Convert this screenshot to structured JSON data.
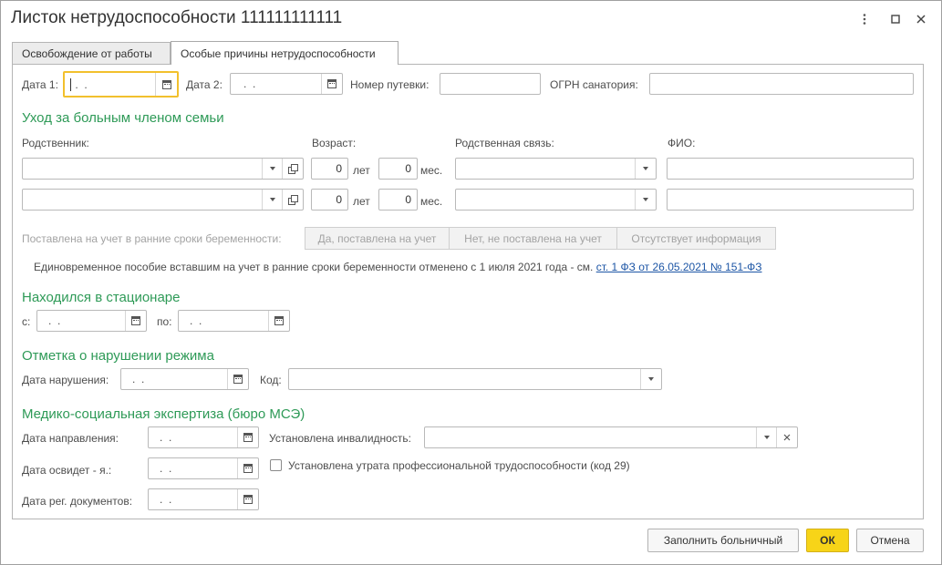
{
  "window": {
    "title": "Листок нетрудоспособности 111111111111",
    "more_icon": "more-vertical-icon",
    "maximize_icon": "maximize-icon",
    "close_icon": "close-icon"
  },
  "tabs": [
    {
      "label": "Освобождение от работы",
      "active": false
    },
    {
      "label": "Особые причины нетрудоспособности",
      "active": true
    }
  ],
  "top_row": {
    "date1_label": "Дата 1:",
    "date1_value": " .  .",
    "date2_label": "Дата 2:",
    "date2_value": ".  .",
    "voucher_label": "Номер путевки:",
    "voucher_value": "",
    "ogrn_label": "ОГРН санатория:",
    "ogrn_value": ""
  },
  "family_care": {
    "section_title": "Уход за больным членом семьи",
    "col_relative": "Родственник:",
    "col_age": "Возраст:",
    "col_relation": "Родственная связь:",
    "col_fio": "ФИО:",
    "rows": [
      {
        "relative": "",
        "years": "0",
        "years_unit": "лет",
        "months": "0",
        "months_unit": "мес.",
        "relation": "",
        "fio": ""
      },
      {
        "relative": "",
        "years": "0",
        "years_unit": "лет",
        "months": "0",
        "months_unit": "мес.",
        "relation": "",
        "fio": ""
      }
    ]
  },
  "pregnancy": {
    "label": "Поставлена на учет в ранние сроки беременности:",
    "options": [
      "Да, поставлена на учет",
      "Нет, не поставлена на учет",
      "Отсутствует информация"
    ],
    "note": "Единовременное пособие вставшим на учет в ранние сроки беременности отменено с 1 июля 2021 года - см.",
    "link": "ст. 1 ФЗ от 26.05.2021 № 151-ФЗ"
  },
  "hospital": {
    "section_title": "Находился в стационаре",
    "from_label": "с:",
    "from_value": ".  .",
    "to_label": "по:",
    "to_value": ".  ."
  },
  "violation": {
    "section_title": "Отметка о нарушении режима",
    "date_label": "Дата нарушения:",
    "date_value": ".  .",
    "code_label": "Код:",
    "code_value": ""
  },
  "mse": {
    "section_title": "Медико-социальная экспертиза (бюро МСЭ)",
    "referral_label": "Дата направления:",
    "referral_value": ".  .",
    "exam_label": "Дата освидет - я.:",
    "exam_value": ".  .",
    "reg_label": "Дата рег. документов:",
    "reg_value": ".  .",
    "disability_label": "Установлена инвалидность:",
    "disability_value": "",
    "loss_label": "Установлена утрата профессиональной трудоспособности (код 29)",
    "loss_checked": false
  },
  "footer": {
    "fill_button": "Заполнить больничный",
    "ok_button": "ОК",
    "cancel_button": "Отмена"
  },
  "colors": {
    "section": "#2e9a57",
    "focus": "#f2c02d",
    "ok": "#f7d418",
    "link": "#1c55a5"
  }
}
